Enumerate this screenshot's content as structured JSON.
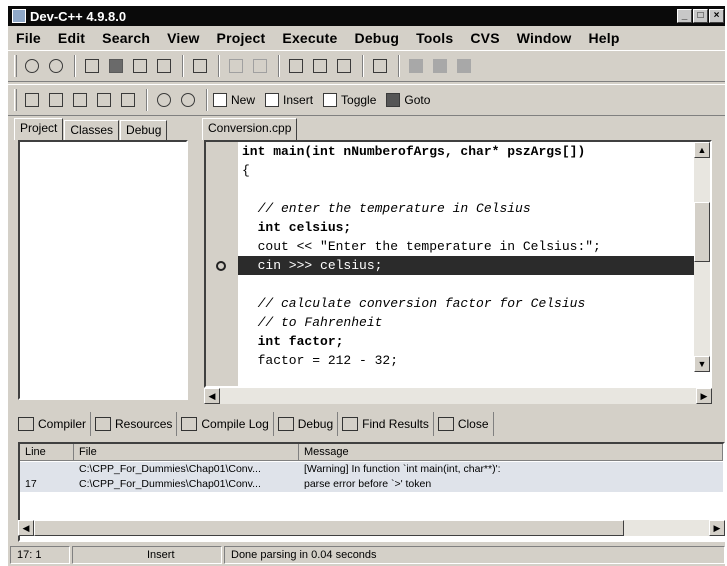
{
  "window": {
    "title": "Dev-C++ 4.9.8.0",
    "minimize": "_",
    "maximize": "□",
    "close": "×"
  },
  "menu": [
    "File",
    "Edit",
    "Search",
    "View",
    "Project",
    "Execute",
    "Debug",
    "Tools",
    "CVS",
    "Window",
    "Help"
  ],
  "toolbar2": {
    "new_label": "New",
    "insert_label": "Insert",
    "toggle_label": "Toggle",
    "goto_label": "Goto"
  },
  "left_tabs": [
    "Project",
    "Classes",
    "Debug"
  ],
  "editor_tab": "Conversion.cpp",
  "code_lines": [
    "int main(int nNumberofArgs, char* pszArgs[])",
    "{",
    "",
    "  // enter the temperature in Celsius",
    "  int celsius;",
    "  cout << \"Enter the temperature in Celsius:\";",
    "  cin >>> celsius;",
    "",
    "  // calculate conversion factor for Celsius",
    "  // to Fahrenheit",
    "  int factor;",
    "  factor = 212 - 32;"
  ],
  "bottom_tabs": [
    "Compiler",
    "Resources",
    "Compile Log",
    "Debug",
    "Find Results",
    "Close"
  ],
  "messages": {
    "headers": {
      "line": "Line",
      "file": "File",
      "message": "Message"
    },
    "rows": [
      {
        "line": "",
        "file": "C:\\CPP_For_Dummies\\Chap01\\Conv...",
        "message": "[Warning] In function `int main(int, char**)':"
      },
      {
        "line": "17",
        "file": "C:\\CPP_For_Dummies\\Chap01\\Conv...",
        "message": "parse error before `>' token"
      }
    ]
  },
  "status": {
    "position": "17: 1",
    "mode": "Insert",
    "message": "Done parsing in 0.04 seconds"
  }
}
